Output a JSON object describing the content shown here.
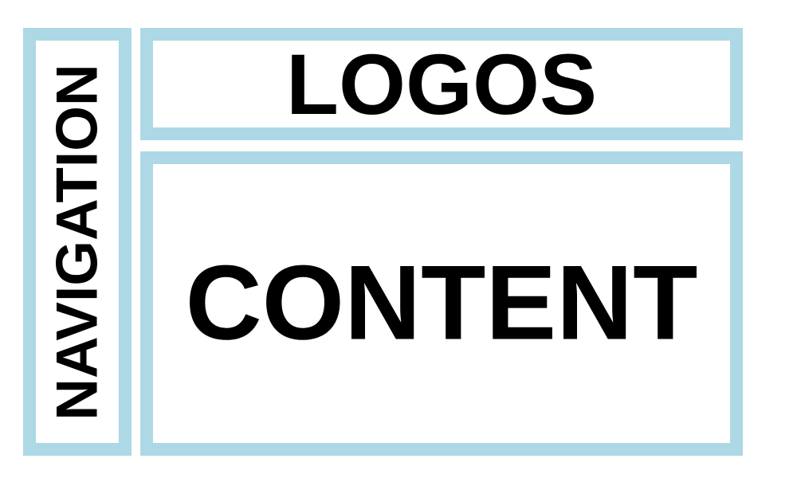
{
  "navigation": {
    "label": "NAVIGATION"
  },
  "logos": {
    "label": "LOGOS"
  },
  "content": {
    "label": "CONTENT"
  },
  "colors": {
    "border": "#add8e6",
    "text": "#000000"
  }
}
